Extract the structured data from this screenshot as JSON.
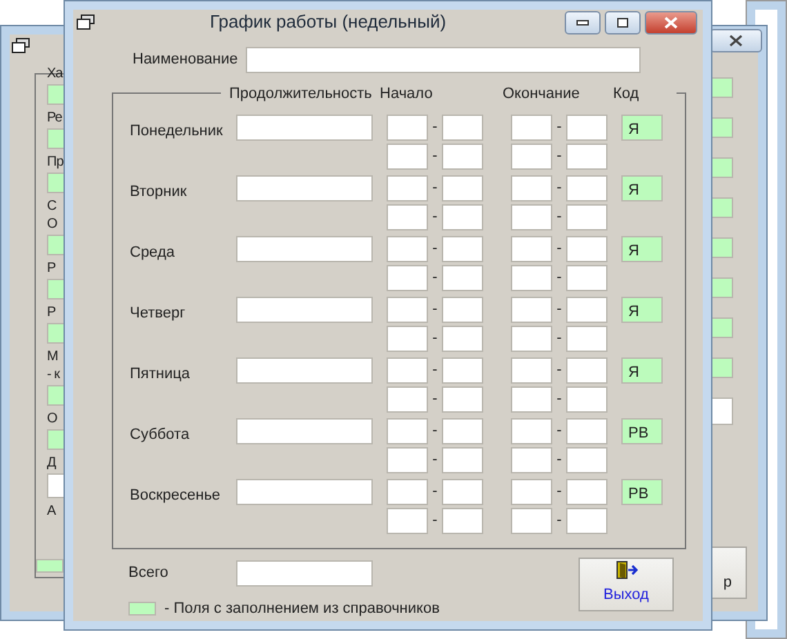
{
  "background_window": {
    "left_items": [
      {
        "kind": "label",
        "text": "Ха"
      },
      {
        "kind": "lookup"
      },
      {
        "kind": "label",
        "text": "Ре"
      },
      {
        "kind": "lookup"
      },
      {
        "kind": "label",
        "text": "Пр"
      },
      {
        "kind": "lookup"
      },
      {
        "kind": "label",
        "text": "С"
      },
      {
        "kind": "label",
        "text": "О"
      },
      {
        "kind": "lookup"
      },
      {
        "kind": "label",
        "text": "Р"
      },
      {
        "kind": "lookup"
      },
      {
        "kind": "label",
        "text": "Р"
      },
      {
        "kind": "lookup"
      },
      {
        "kind": "label",
        "text": "М"
      },
      {
        "kind": "label",
        "text": "- к"
      },
      {
        "kind": "lookup"
      },
      {
        "kind": "label",
        "text": "О"
      },
      {
        "kind": "lookup"
      },
      {
        "kind": "label",
        "text": "Д"
      },
      {
        "kind": "plain"
      },
      {
        "kind": "label",
        "text": "А"
      }
    ],
    "right_fields": [
      {
        "kind": "lookup"
      },
      {
        "kind": "lookup"
      },
      {
        "kind": "lookup"
      },
      {
        "kind": "lookup"
      },
      {
        "kind": "lookup"
      },
      {
        "kind": "lookup"
      },
      {
        "kind": "lookup"
      },
      {
        "kind": "lookup"
      },
      {
        "kind": "plain"
      }
    ],
    "button_text": "р"
  },
  "dialog": {
    "title": "График работы (недельный)",
    "name_label": "Наименование",
    "columns": [
      "Продолжительность",
      "Начало",
      "Окончание",
      "Код"
    ],
    "days": [
      {
        "name": "Понедельник",
        "start_dashes": [
          "-",
          "-"
        ],
        "end_dashes": [
          "-",
          "-"
        ],
        "code": "Я"
      },
      {
        "name": "Вторник",
        "start_dashes": [
          "-",
          "-"
        ],
        "end_dashes": [
          "-",
          "-"
        ],
        "code": "Я"
      },
      {
        "name": "Среда",
        "start_dashes": [
          "-",
          "-"
        ],
        "end_dashes": [
          "-",
          "-"
        ],
        "code": "Я"
      },
      {
        "name": "Четверг",
        "start_dashes": [
          "-",
          "-"
        ],
        "end_dashes": [
          "-",
          "-"
        ],
        "code": "Я"
      },
      {
        "name": "Пятница",
        "start_dashes": [
          "-",
          "-"
        ],
        "end_dashes": [
          "-",
          "-"
        ],
        "code": "Я"
      },
      {
        "name": "Суббота",
        "start_dashes": [
          "-",
          "-"
        ],
        "end_dashes": [
          "-",
          "-"
        ],
        "code": "РВ"
      },
      {
        "name": "Воскресенье",
        "start_dashes": [
          "-",
          "-"
        ],
        "end_dashes": [
          "-",
          "-"
        ],
        "code": "РВ"
      }
    ],
    "total_label": "Всего",
    "legend": "- Поля с заполнением из справочников",
    "exit_button": "Выход"
  }
}
